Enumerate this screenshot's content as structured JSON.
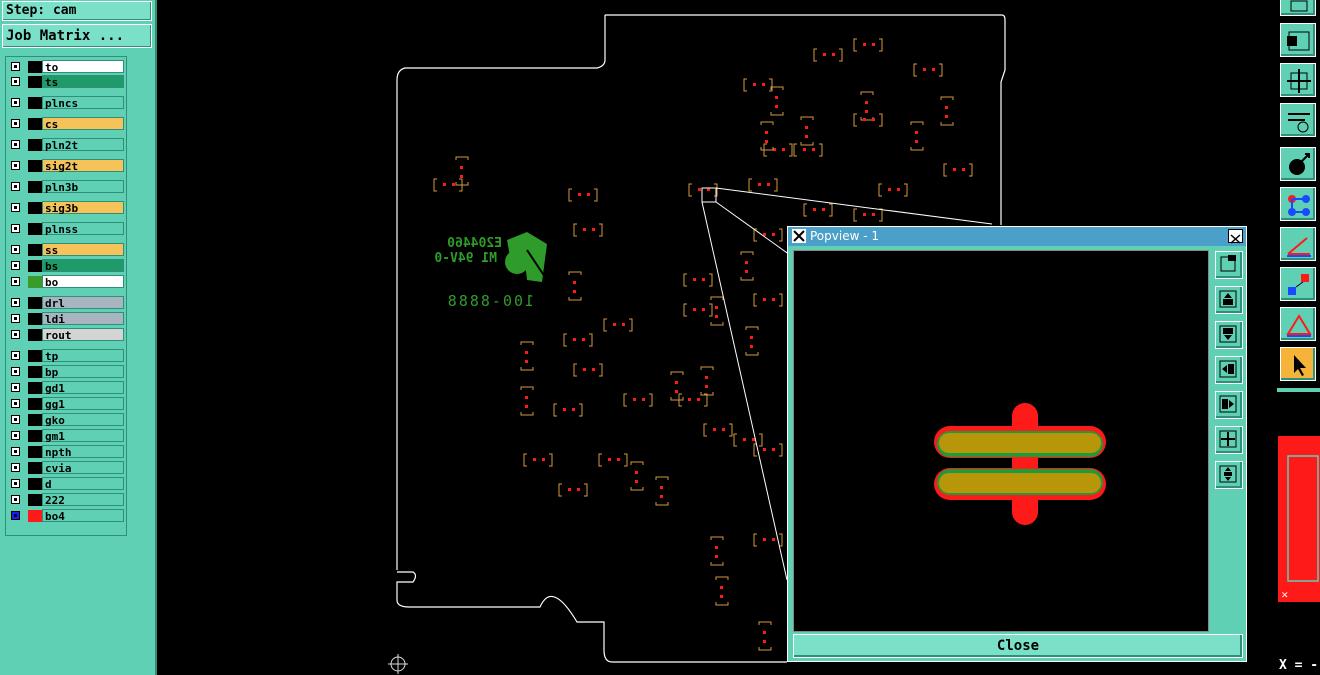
{
  "step_label": "Step: cam",
  "job_matrix_label": "Job Matrix ...",
  "layers": [
    {
      "name": "to",
      "color": "#ffffff",
      "swatch": "#000000"
    },
    {
      "name": "ts",
      "color": "#1f9b6a",
      "swatch": "#000000"
    },
    {
      "name": "plncs",
      "color": "#5fd0b4",
      "swatch": "#000000"
    },
    {
      "name": "cs",
      "color": "#f5c35a",
      "swatch": "#000000"
    },
    {
      "name": "pln2t",
      "color": "#5fd0b4",
      "swatch": "#000000"
    },
    {
      "name": "sig2t",
      "color": "#f5c35a",
      "swatch": "#000000"
    },
    {
      "name": "pln3b",
      "color": "#5fd0b4",
      "swatch": "#000000"
    },
    {
      "name": "sig3b",
      "color": "#f5c35a",
      "swatch": "#000000"
    },
    {
      "name": "plnss",
      "color": "#5fd0b4",
      "swatch": "#000000"
    },
    {
      "name": "ss",
      "color": "#f5c35a",
      "swatch": "#000000"
    },
    {
      "name": "bs",
      "color": "#1f9b6a",
      "swatch": "#000000"
    },
    {
      "name": "bo",
      "color": "#ffffff",
      "swatch": "#3a9b2a"
    },
    {
      "name": "drl",
      "color": "#a8b4bf",
      "swatch": "#000000"
    },
    {
      "name": "ldi",
      "color": "#a8b4bf",
      "swatch": "#000000"
    },
    {
      "name": "rout",
      "color": "#d4d4d4",
      "swatch": "#000000"
    },
    {
      "name": "tp",
      "color": "#5fd0b4",
      "swatch": "#000000"
    },
    {
      "name": "bp",
      "color": "#5fd0b4",
      "swatch": "#000000"
    },
    {
      "name": "gd1",
      "color": "#5fd0b4",
      "swatch": "#000000"
    },
    {
      "name": "gg1",
      "color": "#5fd0b4",
      "swatch": "#000000"
    },
    {
      "name": "gko",
      "color": "#5fd0b4",
      "swatch": "#000000"
    },
    {
      "name": "gm1",
      "color": "#5fd0b4",
      "swatch": "#000000"
    },
    {
      "name": "npth",
      "color": "#5fd0b4",
      "swatch": "#000000"
    },
    {
      "name": "cvia",
      "color": "#5fd0b4",
      "swatch": "#000000"
    },
    {
      "name": "d",
      "color": "#5fd0b4",
      "swatch": "#000000"
    },
    {
      "name": "222",
      "color": "#5fd0b4",
      "swatch": "#000000"
    },
    {
      "name": "bo4",
      "color": "#5fd0b4",
      "swatch": "#ff1a1a"
    }
  ],
  "board_text": {
    "logo_line1": "E204460",
    "logo_line2": "M1 94V-0",
    "part_number": "100-8888"
  },
  "popview": {
    "title": "Popview - 1",
    "close_label": "Close"
  },
  "coord_readout": "X = -",
  "colors": {
    "panel": "#5fd0b4",
    "outline": "#ffffff",
    "silk": "#d59a3b",
    "pad_red": "#ff1a1a",
    "pad_gold": "#b8960a",
    "pad_green": "#1f9b3a"
  },
  "icons": [
    "zoom-fit-icon",
    "zoom-in-icon",
    "zoom-out-icon",
    "pan-left-icon",
    "pan-right-icon",
    "zoom-home-icon",
    "zoom-area-icon"
  ]
}
